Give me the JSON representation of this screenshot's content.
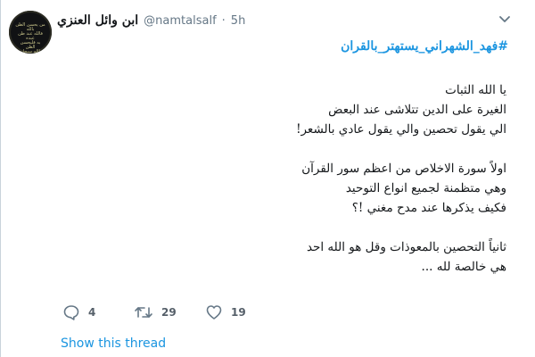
{
  "tweet": {
    "display_name": "ابن وائل العنزي",
    "handle": "@namtalsalf",
    "separator": "·",
    "time": "5h",
    "avatar_text": "من يحسن الظن بالله\nفالله عند ظن عبده\nبه فليحسن الظن\nبالله سبحانه",
    "hashtag": "#فهد_الشهراني_يستهتر_بالقران",
    "lines": [
      "يا الله الثبات",
      "الغيرة على الدين تتلاشى عند البعض",
      "الي يقول تحصين والي يقول عادي بالشعر!",
      "",
      "اولاً سورة الاخلاص من اعظم سور القرآن",
      "وهي متظمنة لجميع انواع التوحيد",
      "فكيف يذكرها عند مدح مغني !؟",
      "",
      "ثانياً التحصين بالمعوذات وقل هو الله احد",
      "هي خالصة لله ..."
    ],
    "actions": {
      "reply_count": "4",
      "retweet_count": "29",
      "like_count": "19"
    },
    "show_thread": "Show this thread"
  },
  "icons": {
    "menu": "chevron-down-icon",
    "reply": "reply-icon",
    "retweet": "retweet-icon",
    "like": "heart-icon"
  },
  "colors": {
    "link": "#1b95e0",
    "secondary_text": "#657786",
    "action_icon": "#657786"
  }
}
